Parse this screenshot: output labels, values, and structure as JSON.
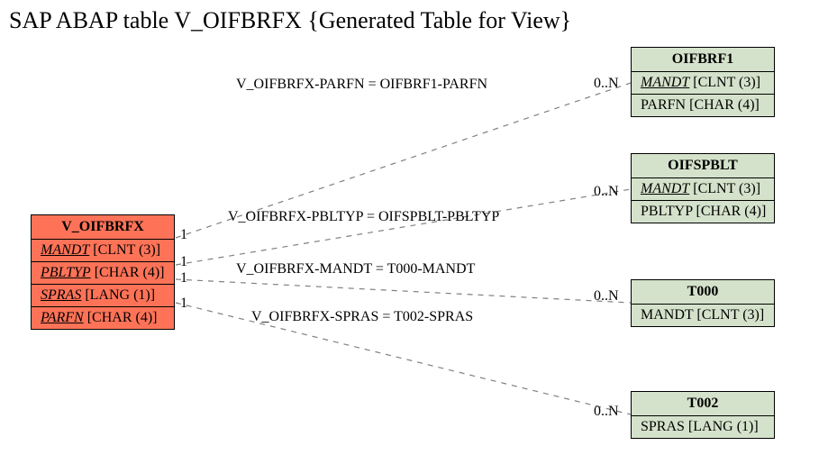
{
  "title": "SAP ABAP table V_OIFBRFX {Generated Table for View}",
  "main": {
    "name": "V_OIFBRFX",
    "fields": [
      {
        "fk": "MANDT",
        "type": "[CLNT (3)]"
      },
      {
        "fk": "PBLTYP",
        "type": "[CHAR (4)]"
      },
      {
        "fk": "SPRAS",
        "type": "[LANG (1)]"
      },
      {
        "fk": "PARFN",
        "type": "[CHAR (4)]"
      }
    ]
  },
  "targets": {
    "oifbrf1": {
      "name": "OIFBRF1",
      "fields": [
        {
          "fk": "MANDT",
          "type": "[CLNT (3)]"
        },
        {
          "plain": "PARFN",
          "type": "[CHAR (4)]"
        }
      ]
    },
    "oifspblt": {
      "name": "OIFSPBLT",
      "fields": [
        {
          "fk": "MANDT",
          "type": "[CLNT (3)]"
        },
        {
          "plain": "PBLTYP",
          "type": "[CHAR (4)]"
        }
      ]
    },
    "t000": {
      "name": "T000",
      "fields": [
        {
          "plain": "MANDT",
          "type": "[CLNT (3)]"
        }
      ]
    },
    "t002": {
      "name": "T002",
      "fields": [
        {
          "plain": "SPRAS",
          "type": "[LANG (1)]"
        }
      ]
    }
  },
  "relations": {
    "r1": {
      "label": "V_OIFBRFX-PARFN = OIFBRF1-PARFN",
      "left_card": "1",
      "right_card": "0..N"
    },
    "r2": {
      "label": "V_OIFBRFX-PBLTYP = OIFSPBLT-PBLTYP",
      "left_card": "1",
      "right_card": "0..N"
    },
    "r3": {
      "label": "V_OIFBRFX-MANDT = T000-MANDT",
      "left_card": "1",
      "right_card": "0..N"
    },
    "r4": {
      "label": "V_OIFBRFX-SPRAS = T002-SPRAS",
      "left_card": "1",
      "right_card": "0..N"
    }
  }
}
